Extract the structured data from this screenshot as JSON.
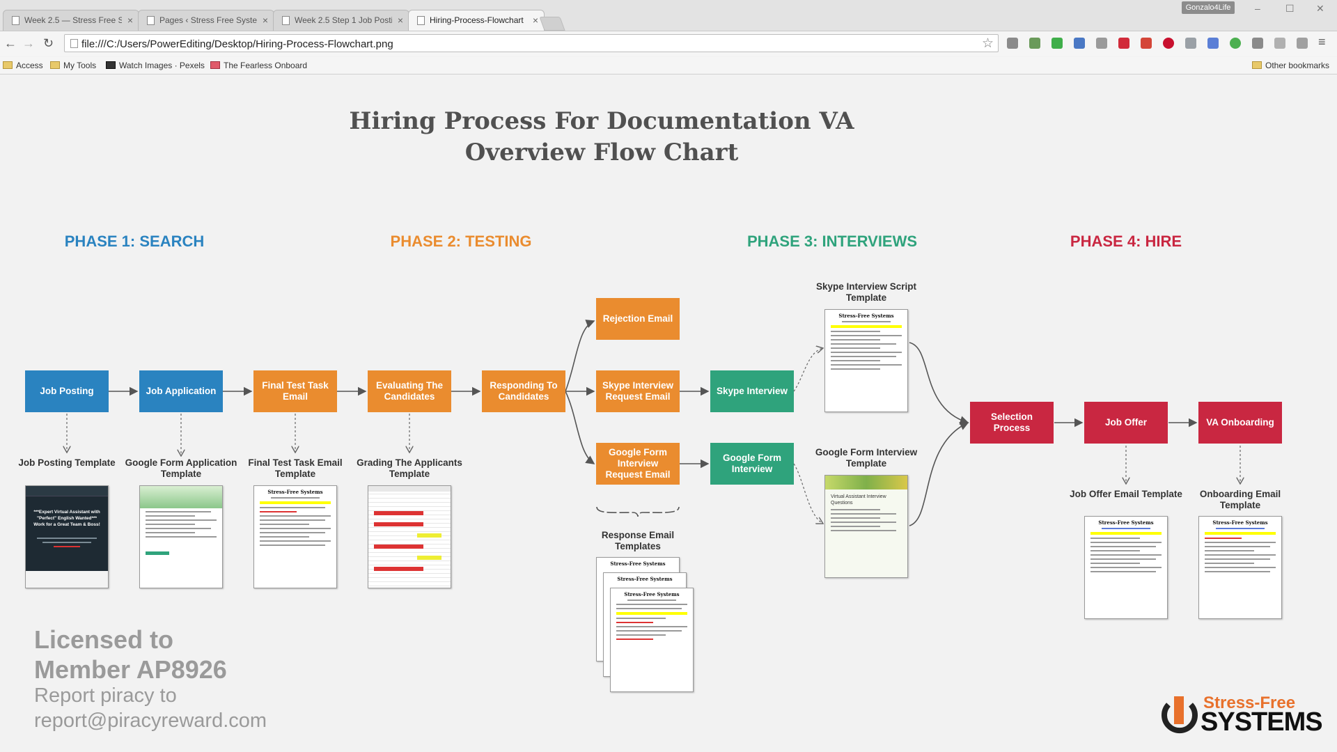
{
  "browser": {
    "tabs": [
      {
        "label": "Week 2.5 — Stress Free S",
        "active": false
      },
      {
        "label": "Pages ‹ Stress Free Syster",
        "active": false
      },
      {
        "label": "Week 2.5 Step 1 Job Posti",
        "active": false
      },
      {
        "label": "Hiring-Process-Flowchart",
        "active": true
      }
    ],
    "user_badge": "Gonzalo4Life",
    "url": "file:///C:/Users/PowerEditing/Desktop/Hiring-Process-Flowchart.png",
    "bookmarks": [
      "Access",
      "My Tools",
      "Watch Images · Pexels",
      "The Fearless Onboard"
    ],
    "other_bookmarks": "Other bookmarks"
  },
  "flowchart": {
    "title_line1": "Hiring Process For Documentation VA",
    "title_line2": "Overview Flow Chart",
    "phases": [
      {
        "label": "PHASE 1: SEARCH",
        "color": "#2a83c0"
      },
      {
        "label": "PHASE 2: TESTING",
        "color": "#ea8c2f"
      },
      {
        "label": "PHASE 3: INTERVIEWS",
        "color": "#2fa37c"
      },
      {
        "label": "PHASE 4: HIRE",
        "color": "#c92741"
      }
    ],
    "steps": {
      "job_posting": "Job Posting",
      "job_application": "Job Application",
      "final_test_task_email": "Final Test Task Email",
      "evaluating_candidates": "Evaluating The Candidates",
      "responding_candidates": "Responding To Candidates",
      "rejection_email": "Rejection Email",
      "skype_request_email": "Skype Interview Request Email",
      "gform_request_email": "Google Form Interview Request Email",
      "skype_interview": "Skype Interview",
      "gform_interview": "Google Form Interview",
      "selection_process": "Selection Process",
      "job_offer": "Job Offer",
      "va_onboarding": "VA Onboarding"
    },
    "templates": {
      "job_posting": "Job Posting Template",
      "gform_app": "Google Form Application Template",
      "final_test": "Final Test Task Email Template",
      "grading": "Grading The Applicants Template",
      "response_emails": "Response Email Templates",
      "skype_script": "Skype Interview Script Template",
      "gform_interview": "Google Form Interview Template",
      "job_offer": "Job Offer Email Template",
      "onboarding": "Onboarding Email Template"
    },
    "doc_header": "Stress-Free Systems",
    "job_post_thumb_text": "***Expert Virtual Assistant with \"Perfect\" English Wanted*** Work for a Great Team & Boss!",
    "gform_thumb_text": "Virtual Assistant Interview Questions",
    "watermark": {
      "line1": "Licensed to",
      "line2": "Member AP8926",
      "line3": "Report piracy to",
      "line4": "report@piracyreward.com"
    },
    "logo": {
      "top": "Stress-Free",
      "bottom": "SYSTEMS"
    }
  }
}
